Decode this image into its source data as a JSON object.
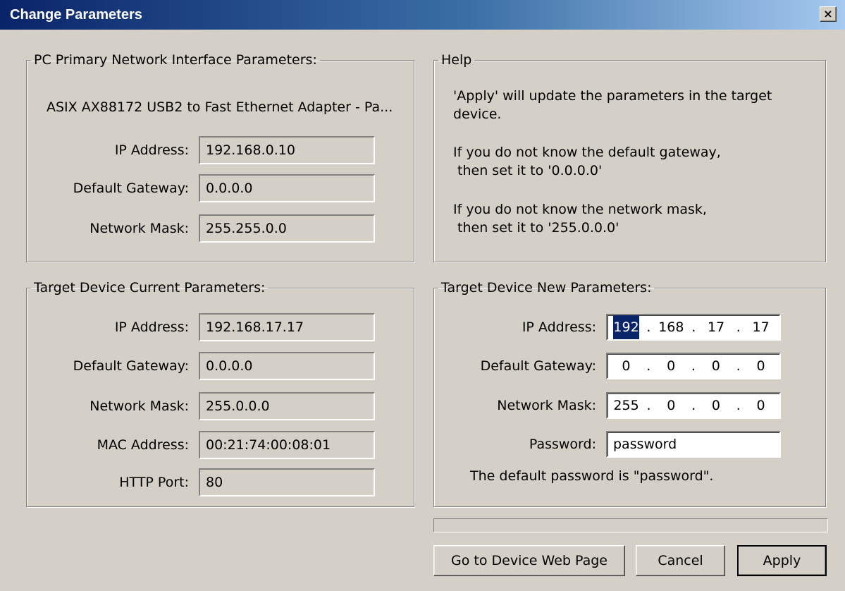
{
  "window": {
    "title": "Change Parameters",
    "close_glyph": "×"
  },
  "pc_group": {
    "legend": "PC Primary Network Interface Parameters:",
    "adapter": "ASIX AX88172 USB2 to Fast Ethernet Adapter - Pa...",
    "ip_label": "IP Address:",
    "ip_value": "192.168.0.10",
    "gw_label": "Default Gateway:",
    "gw_value": "0.0.0.0",
    "mask_label": "Network Mask:",
    "mask_value": "255.255.0.0"
  },
  "help_group": {
    "legend": "Help",
    "text1": "'Apply' will update the parameters in the target\ndevice.",
    "text2": "If you do not know the default gateway,\n then set it to '0.0.0.0'",
    "text3": "If you do not know the network mask,\n then set it to '255.0.0.0'"
  },
  "current_group": {
    "legend": "Target Device Current Parameters:",
    "ip_label": "IP Address:",
    "ip_value": "192.168.17.17",
    "gw_label": "Default Gateway:",
    "gw_value": "0.0.0.0",
    "mask_label": "Network Mask:",
    "mask_value": "255.0.0.0",
    "mac_label": "MAC Address:",
    "mac_value": "00:21:74:00:08:01",
    "port_label": "HTTP Port:",
    "port_value": "80"
  },
  "new_group": {
    "legend": "Target Device New Parameters:",
    "ip_label": "IP Address:",
    "ip_octets": [
      "192",
      "168",
      "17",
      "17"
    ],
    "gw_label": "Default Gateway:",
    "gw_octets": [
      "0",
      "0",
      "0",
      "0"
    ],
    "mask_label": "Network Mask:",
    "mask_octets": [
      "255",
      "0",
      "0",
      "0"
    ],
    "password_label": "Password:",
    "password_value": "password",
    "password_hint": "The default password is \"password\"."
  },
  "progress": {
    "value": 0
  },
  "buttons": {
    "web_page": "Go to Device Web Page",
    "cancel": "Cancel",
    "apply": "Apply"
  },
  "icons": {
    "close": "close-icon"
  }
}
